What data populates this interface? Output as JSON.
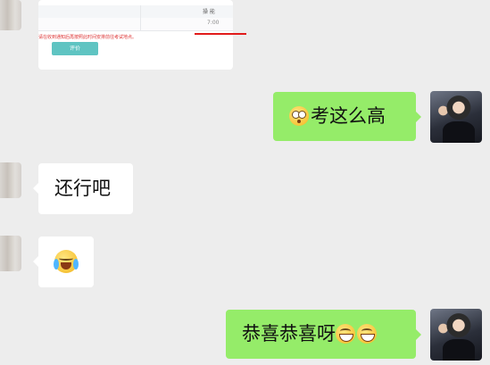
{
  "chat": {
    "screenshot": {
      "header_label": "操 能",
      "header_value": "7:00",
      "note": "请在收到通知后再按照此时间安排前往考试地点。",
      "button_label": "评价"
    },
    "messages": [
      {
        "side": "right",
        "emoji": "surprise-face",
        "text": "考这么高"
      },
      {
        "side": "left",
        "text": "还行吧"
      },
      {
        "side": "left",
        "emoji": "crying-laughing-face",
        "text": ""
      },
      {
        "side": "right",
        "text": "恭喜恭喜呀",
        "emoji": "grinning-face"
      }
    ]
  },
  "colors": {
    "background": "#ededed",
    "self_bubble": "#95ec69",
    "other_bubble": "#ffffff",
    "annotation_red": "#e11b1b",
    "button_teal": "#5fc4c2"
  }
}
